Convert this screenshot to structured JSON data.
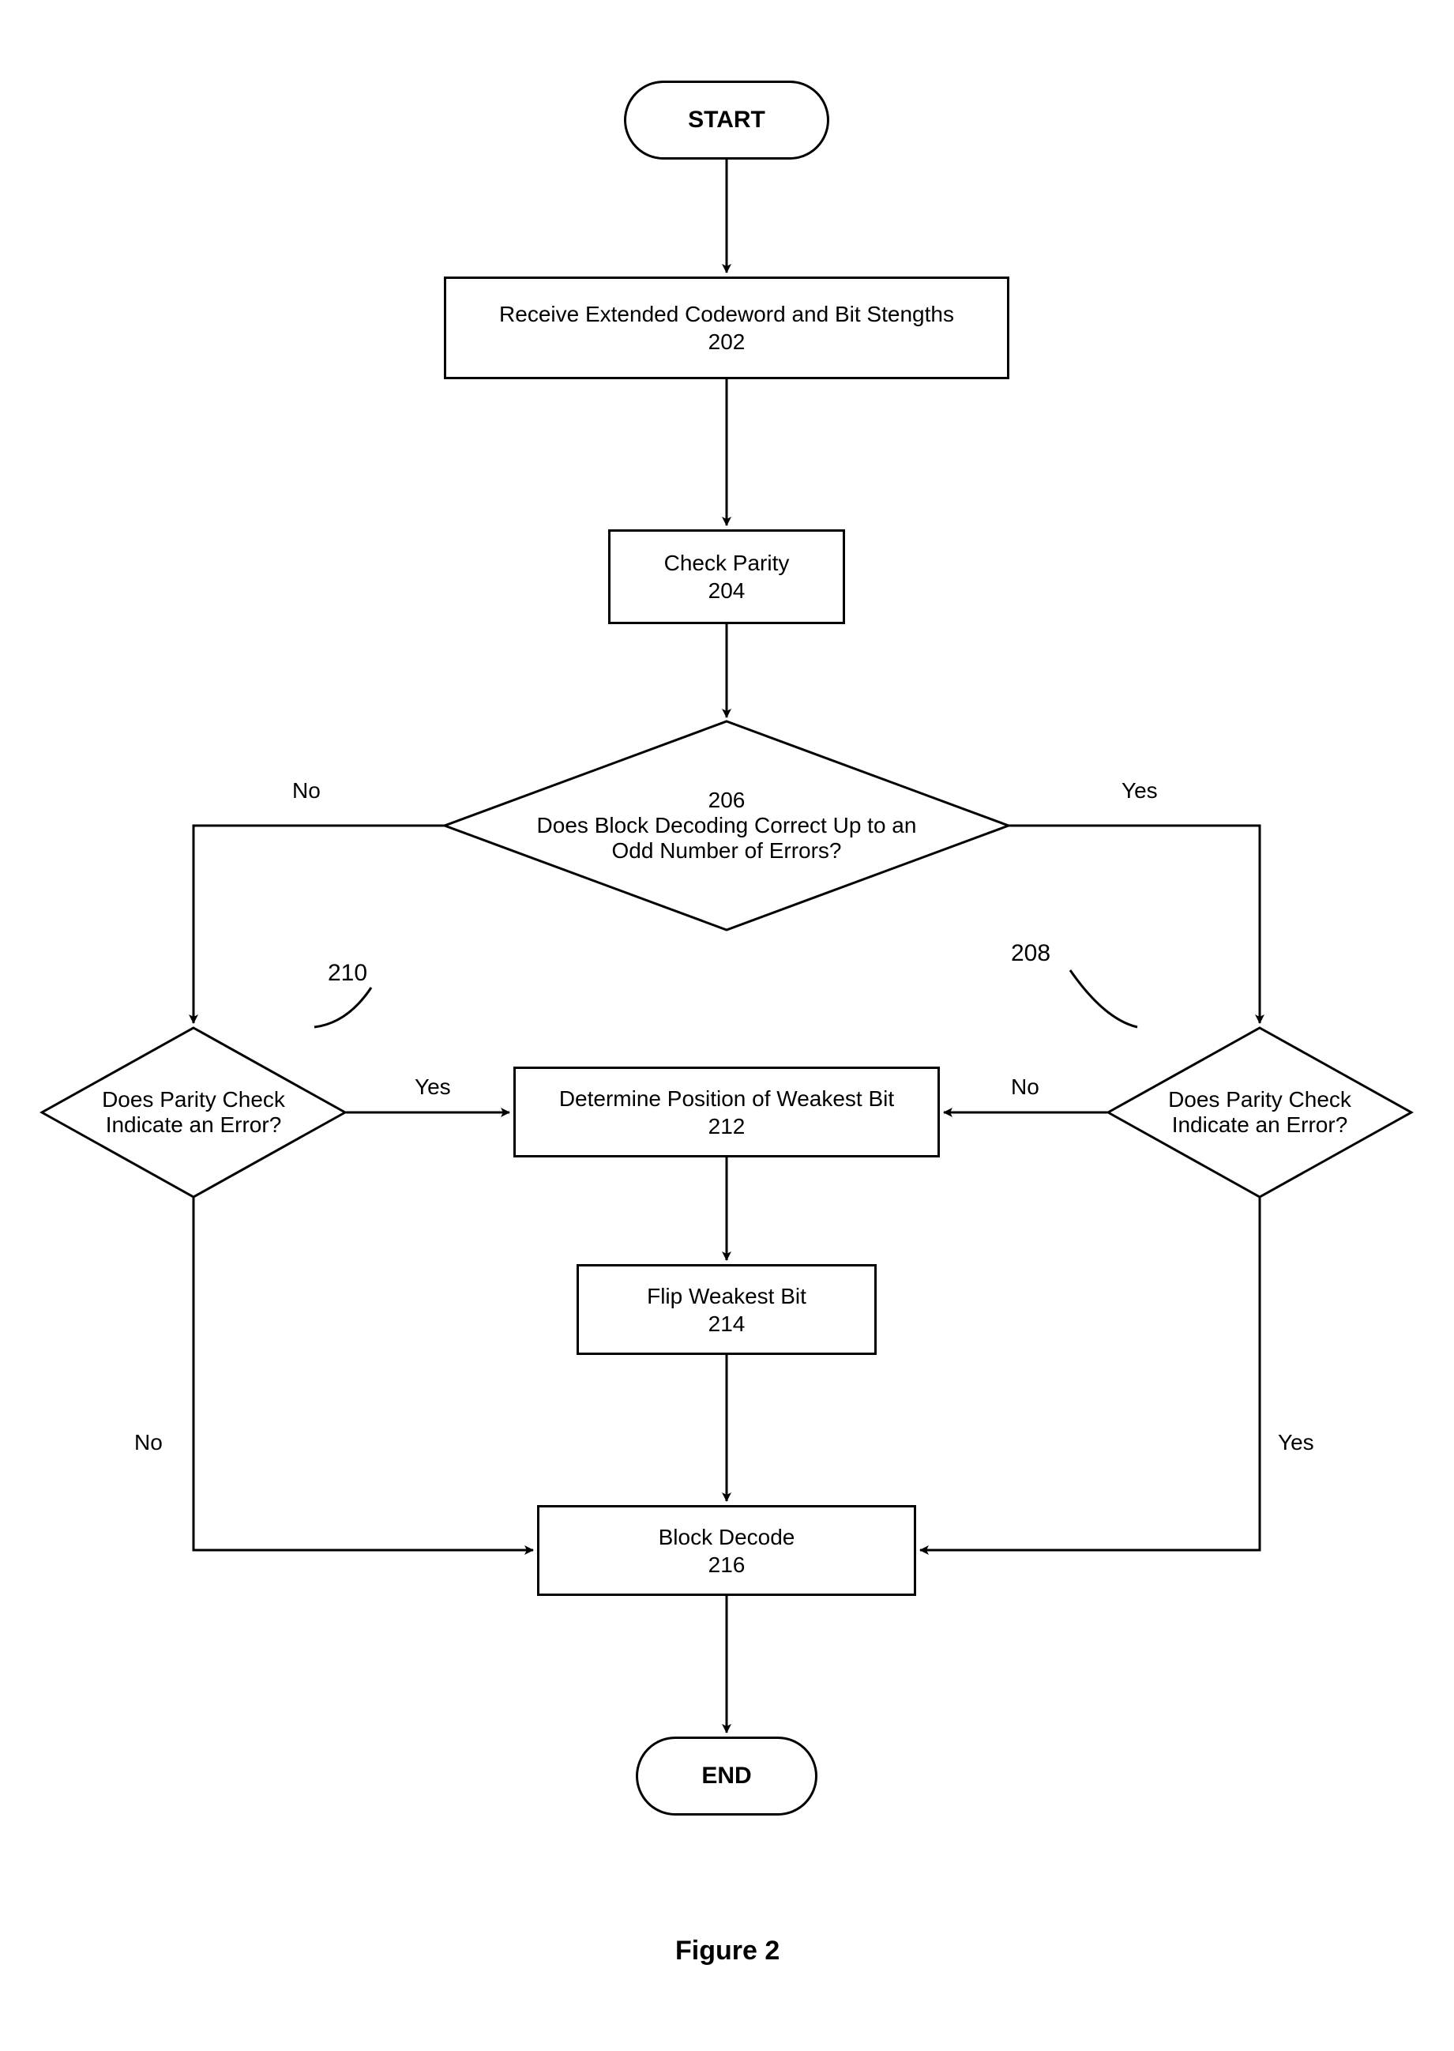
{
  "caption": "Figure 2",
  "nodes": {
    "start": {
      "label": "START"
    },
    "receive": {
      "title": "Receive Extended Codeword and Bit Stengths",
      "ref": "202"
    },
    "checkParity": {
      "title": "Check Parity",
      "ref": "204"
    },
    "decisionOdd": {
      "ref": "206",
      "title": "Does Block Decoding Correct Up to an\nOdd Number of Errors?"
    },
    "decisionLeft": {
      "title": "Does Parity Check\nIndicate an Error?"
    },
    "decisionRight": {
      "title": "Does Parity Check\nIndicate an Error?"
    },
    "weakestPos": {
      "title": "Determine Position of Weakest Bit",
      "ref": "212"
    },
    "flip": {
      "title": "Flip Weakest Bit",
      "ref": "214"
    },
    "blockDecode": {
      "title": "Block Decode",
      "ref": "216"
    },
    "end": {
      "label": "END"
    }
  },
  "refs": {
    "leftDecision": "210",
    "rightDecision": "208"
  },
  "edgeLabels": {
    "oddNo": "No",
    "oddYes": "Yes",
    "leftYes": "Yes",
    "leftNo": "No",
    "rightNo": "No",
    "rightYes": "Yes"
  },
  "flow": {
    "description": "Flowchart for decoding an extended codeword using parity check and weakest-bit flipping before block decoding.",
    "steps": [
      "START",
      "202 Receive Extended Codeword and Bit Strengths",
      "204 Check Parity",
      "206 Decision: Does Block Decoding Correct Up to an Odd Number of Errors? → No to 210, Yes to 208",
      "210 Decision (left): Does Parity Check Indicate an Error? → Yes to 212, No to 216",
      "208 Decision (right): Does Parity Check Indicate an Error? → No to 212, Yes to 216",
      "212 Determine Position of Weakest Bit",
      "214 Flip Weakest Bit",
      "216 Block Decode",
      "END"
    ]
  }
}
